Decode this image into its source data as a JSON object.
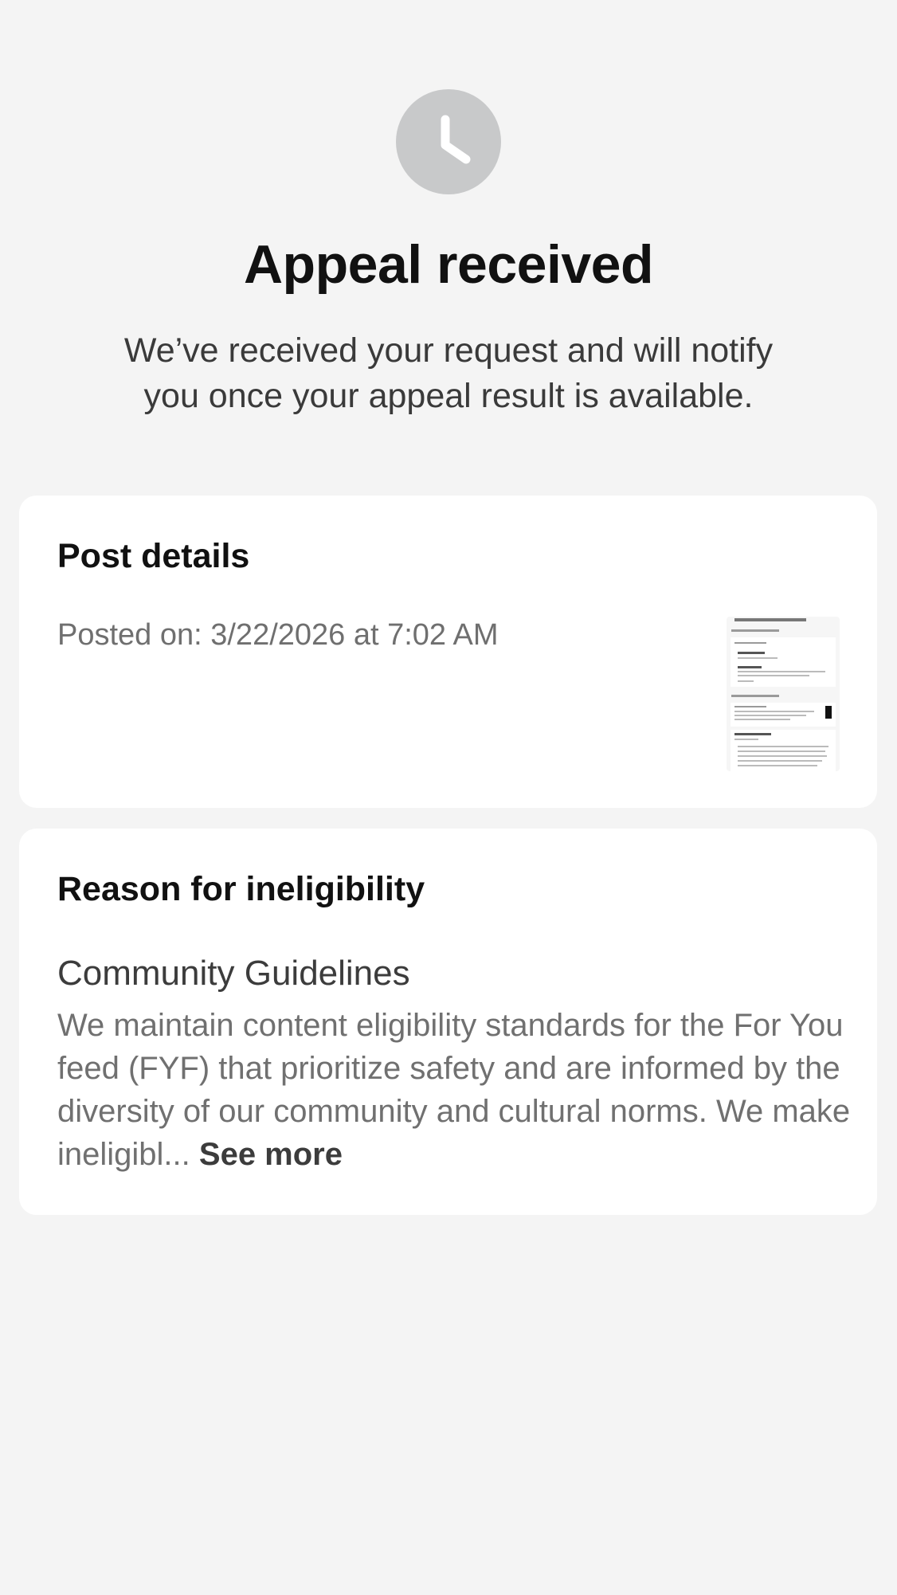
{
  "header": {
    "icon": "clock-icon",
    "title": "Appeal received",
    "subtitle": "We’ve received your request and will notify you once your appeal result is available."
  },
  "post_details": {
    "title": "Post details",
    "posted_on": "Posted on: 3/22/2026 at 7:02 AM",
    "thumbnail": "post-thumbnail"
  },
  "reason": {
    "title": "Reason for ineligibility",
    "heading": "Community Guidelines",
    "body": "We maintain content eligibility standards for the For You feed (FYF) that prioritize safety and are informed by the diversity of our community and cultural norms. We make ineligibl...",
    "see_more": "See more"
  },
  "colors": {
    "background": "#f4f4f4",
    "card": "#ffffff",
    "icon_circle": "#c8c9ca"
  }
}
